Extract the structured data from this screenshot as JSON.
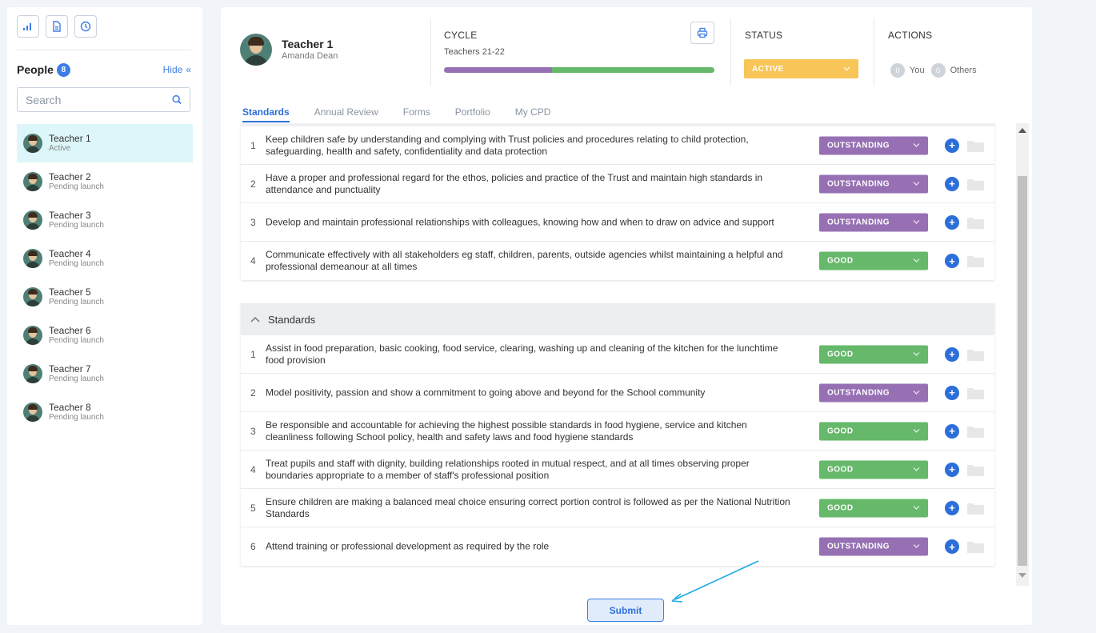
{
  "sidebar": {
    "toolbar_icons": [
      "bar-chart-icon",
      "document-icon",
      "clock-icon"
    ],
    "title": "People",
    "count": "8",
    "hide_label": "Hide",
    "hide_icon": "«",
    "search_placeholder": "Search",
    "people": [
      {
        "name": "Teacher 1",
        "status": "Active"
      },
      {
        "name": "Teacher 2",
        "status": "Pending launch"
      },
      {
        "name": "Teacher 3",
        "status": "Pending launch"
      },
      {
        "name": "Teacher 4",
        "status": "Pending launch"
      },
      {
        "name": "Teacher 5",
        "status": "Pending launch"
      },
      {
        "name": "Teacher 6",
        "status": "Pending launch"
      },
      {
        "name": "Teacher 7",
        "status": "Pending launch"
      },
      {
        "name": "Teacher 8",
        "status": "Pending launch"
      }
    ]
  },
  "header": {
    "teacher_name": "Teacher 1",
    "teacher_sub": "Amanda Dean",
    "cycle_label": "CYCLE",
    "cycle_value": "Teachers 21-22",
    "cycle_progress": 0.4,
    "status_label": "STATUS",
    "status_value": "ACTIVE",
    "actions_label": "ACTIONS",
    "actions_you_count": "0",
    "actions_you_label": "You",
    "actions_others_count": "0",
    "actions_others_label": "Others"
  },
  "tabs": [
    "Standards",
    "Annual Review",
    "Forms",
    "Portfolio",
    "My CPD"
  ],
  "active_tab": "Standards",
  "colors": {
    "outstanding": "#9670b3",
    "good": "#66b86a",
    "status_active": "#f8c558",
    "accent": "#2d6fd8"
  },
  "section1": {
    "rows": [
      {
        "num": "1",
        "text": "Keep children safe by understanding and complying with Trust policies and procedures relating to child protection, safeguarding, health and safety, confidentiality and data protection",
        "rating": "OUTSTANDING"
      },
      {
        "num": "2",
        "text": "Have a proper and professional regard for the ethos, policies and practice of the Trust and maintain high standards in attendance and punctuality",
        "rating": "OUTSTANDING"
      },
      {
        "num": "3",
        "text": "Develop and maintain professional relationships with colleagues, knowing how and when to draw on advice and support",
        "rating": "OUTSTANDING"
      },
      {
        "num": "4",
        "text": "Communicate effectively with all stakeholders eg staff, children, parents, outside agencies whilst maintaining a helpful and professional demeanour at all times",
        "rating": "GOOD"
      }
    ]
  },
  "section2": {
    "title": "Standards",
    "rows": [
      {
        "num": "1",
        "text": "Assist in food preparation, basic cooking, food service, clearing, washing up and cleaning of the kitchen for the lunchtime food provision",
        "rating": "GOOD"
      },
      {
        "num": "2",
        "text": "Model positivity, passion and show a commitment to going above and beyond for the School community",
        "rating": "OUTSTANDING"
      },
      {
        "num": "3",
        "text": "Be responsible and accountable for achieving the highest possible standards in food hygiene, service and kitchen cleanliness following School policy, health and safety laws and food hygiene standards",
        "rating": "GOOD"
      },
      {
        "num": "4",
        "text": "Treat pupils and staff with dignity, building relationships rooted in mutual respect, and at all times observing proper boundaries appropriate to a member of staff's professional position",
        "rating": "GOOD"
      },
      {
        "num": "5",
        "text": "Ensure children are making a balanced meal choice ensuring correct portion control is followed as per the National Nutrition Standards",
        "rating": "GOOD"
      },
      {
        "num": "6",
        "text": "Attend training or professional development as required by the role",
        "rating": "OUTSTANDING"
      }
    ]
  },
  "submit_label": "Submit"
}
